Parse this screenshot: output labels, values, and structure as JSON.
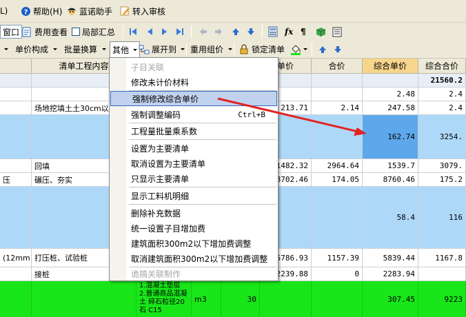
{
  "menubar": {
    "items": [
      {
        "label": "L)"
      },
      {
        "label": "帮助(H)"
      },
      {
        "label": "蓝诺助手"
      },
      {
        "label": "转入审核"
      }
    ]
  },
  "toolbar1": {
    "window": "窗口",
    "fee_view": "费用查看",
    "sub_summary": "局部汇总"
  },
  "toolbar2": {
    "unit_price_composition": "单价构成",
    "batch_convert": "批量换算",
    "other": "其他",
    "expand_to": "展开到",
    "reuse_group_price": "重用组价",
    "lock_bill": "锁定清单"
  },
  "columns": [
    "清单工程内容",
    "单价",
    "合价",
    "综合单价",
    "综合合价"
  ],
  "rows": [
    {
      "left": "",
      "content": "",
      "price": "",
      "total": "",
      "unit_total": "",
      "sum": "21560.2"
    },
    {
      "left": "",
      "content": "",
      "price": "",
      "total": "",
      "unit_total": "2.48",
      "sum": "2.4"
    },
    {
      "left": "",
      "content": "场地挖填土土30cm以",
      "price": "213.71",
      "total": "2.14",
      "unit_total": "247.58",
      "sum": "2.4"
    },
    {
      "left": "",
      "content": "",
      "price": "",
      "total": "",
      "unit_total": "162.74",
      "sum": "3254."
    },
    {
      "left": "",
      "content": "回填",
      "price": "1482.32",
      "total": "2964.64",
      "unit_total": "1539.7",
      "sum": "3079."
    },
    {
      "left": "压",
      "content": "碾压、夯实",
      "price": "8702.46",
      "total": "174.05",
      "unit_total": "8760.46",
      "sum": "175.2"
    },
    {
      "left": "",
      "content": "",
      "price": "",
      "total": "",
      "unit_total": "58.4",
      "sum": "116"
    },
    {
      "left": "(12mm)",
      "content": "打压桩、试验桩",
      "price": "5786.93",
      "total": "1157.39",
      "unit_total": "5839.44",
      "sum": "1167.8"
    },
    {
      "left": "",
      "content": "接桩",
      "price": "2239.88",
      "total": "0",
      "unit_total": "2283.94",
      "sum": ""
    },
    {
      "left": "",
      "content": "",
      "price": "",
      "total": "",
      "unit_total": "307.45",
      "sum": "9223"
    }
  ],
  "green_row": {
    "desc": "1.混凝土垫层\n2.普通商品混凝土 碎石粒径20石 C15",
    "unit": "m3",
    "qty": "30"
  },
  "menu": {
    "items": [
      {
        "label": "子目关联",
        "disabled": true
      },
      {
        "label": "修改未计价材料"
      },
      {
        "label": "强制修改综合单价",
        "highlight": true
      },
      {
        "label": "强制调整编码",
        "shortcut": "Ctrl+B"
      },
      {
        "label": "工程量批量乘系数"
      },
      {
        "label": "设置为主要清单"
      },
      {
        "label": "取消设置为主要清单"
      },
      {
        "label": "只显示主要清单"
      },
      {
        "label": "显示工料机明细"
      },
      {
        "label": "删除补充数据"
      },
      {
        "label": "统一设置子目增加费"
      },
      {
        "label": "建筑面积300m2以下增加费调整"
      },
      {
        "label": "取消建筑面积300m2以下增加费调整"
      },
      {
        "label": "诡搞关联制作",
        "disabled": true
      }
    ]
  },
  "colors": {
    "selected_row": "#aed8f8",
    "green_row": "#19e619",
    "highlight_cell": "#5ea7ea",
    "arrow": "#e32222"
  }
}
